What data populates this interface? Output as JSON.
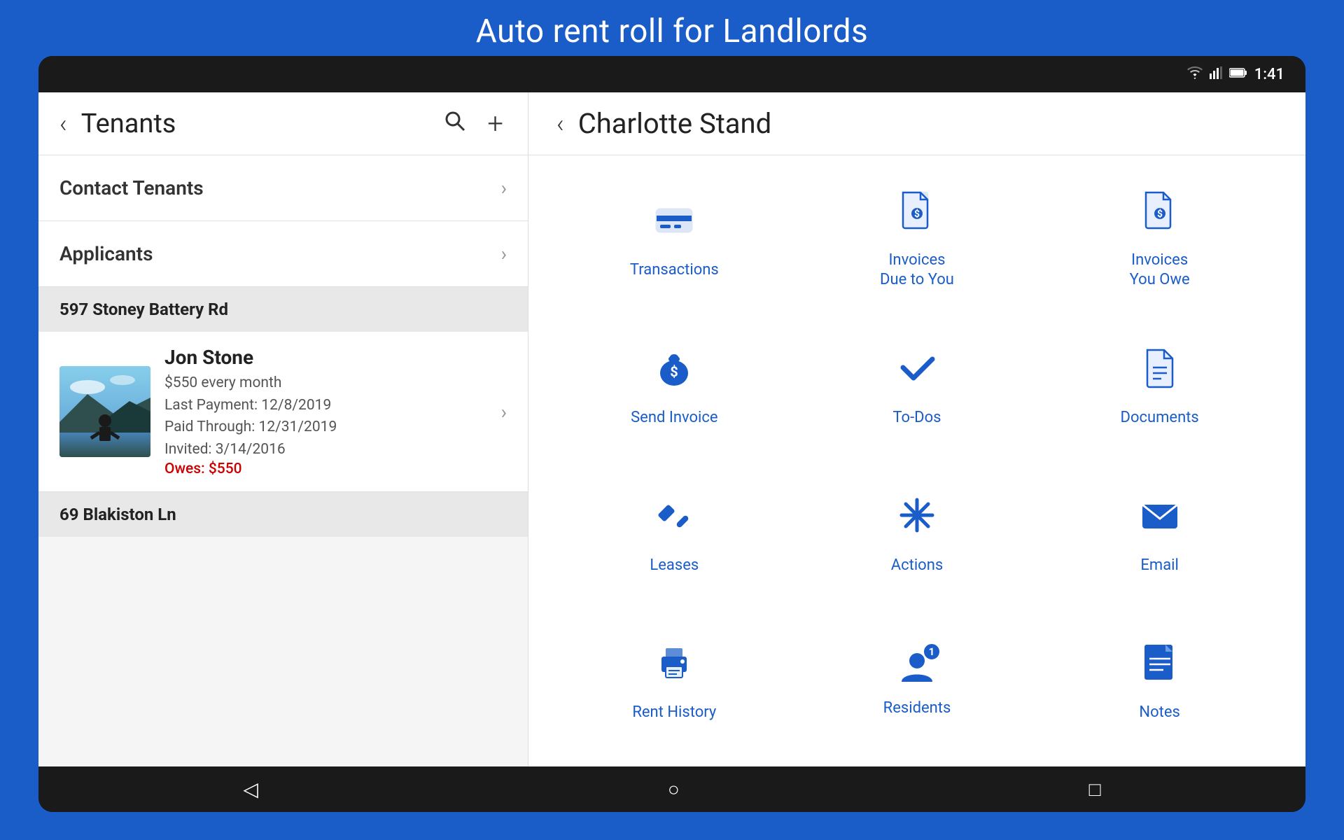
{
  "app_title": "Auto rent roll for Landlords",
  "status_bar": {
    "time": "1:41",
    "icons": [
      "wifi",
      "signal",
      "battery"
    ]
  },
  "left_panel": {
    "header": {
      "back_label": "‹",
      "title": "Tenants",
      "search_icon": "🔍",
      "add_icon": "+"
    },
    "nav_items": [
      {
        "label": "Contact Tenants"
      },
      {
        "label": "Applicants"
      }
    ],
    "addresses": [
      {
        "label": "597 Stoney Battery Rd",
        "tenants": [
          {
            "name": "Jon Stone",
            "rent": "$550 every month",
            "last_payment": "Last Payment: 12/8/2019",
            "paid_through": "Paid Through: 12/31/2019",
            "invited": "Invited: 3/14/2016",
            "owes": "Owes: $550"
          }
        ]
      },
      {
        "label": "69 Blakiston Ln",
        "tenants": []
      }
    ]
  },
  "right_panel": {
    "header": {
      "back_label": "‹",
      "title": "Charlotte Stand"
    },
    "grid_items": [
      {
        "id": "transactions",
        "label": "Transactions",
        "icon": "transactions"
      },
      {
        "id": "invoices-due-to-you",
        "label": "Invoices\nDue to You",
        "icon": "invoice-in"
      },
      {
        "id": "invoices-you-owe",
        "label": "Invoices\nYou Owe",
        "icon": "invoice-out"
      },
      {
        "id": "send-invoice",
        "label": "Send Invoice",
        "icon": "send-invoice"
      },
      {
        "id": "to-dos",
        "label": "To-Dos",
        "icon": "todos"
      },
      {
        "id": "documents",
        "label": "Documents",
        "icon": "documents"
      },
      {
        "id": "leases",
        "label": "Leases",
        "icon": "leases"
      },
      {
        "id": "actions",
        "label": "Actions",
        "icon": "actions"
      },
      {
        "id": "email",
        "label": "Email",
        "icon": "email"
      },
      {
        "id": "rent-history",
        "label": "Rent History",
        "icon": "rent-history"
      },
      {
        "id": "residents",
        "label": "Residents",
        "icon": "residents",
        "badge": "1"
      },
      {
        "id": "notes",
        "label": "Notes",
        "icon": "notes"
      }
    ]
  },
  "bottom_nav": {
    "back_icon": "◁",
    "home_icon": "○",
    "recent_icon": "□"
  }
}
